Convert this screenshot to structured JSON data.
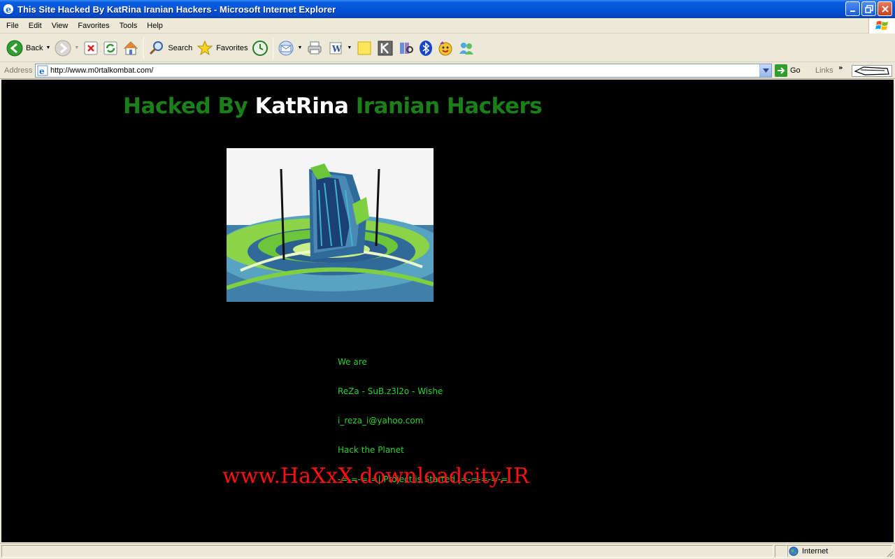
{
  "window": {
    "title": "This Site Hacked By KatRina Iranian Hackers - Microsoft Internet Explorer"
  },
  "menu": [
    "File",
    "Edit",
    "View",
    "Favorites",
    "Tools",
    "Help"
  ],
  "toolbar": {
    "back_label": "Back",
    "search_label": "Search",
    "favorites_label": "Favorites"
  },
  "address": {
    "label": "Address",
    "url": "http://www.m0rtalkombat.com/",
    "go_label": "Go",
    "links_label": "Links"
  },
  "page": {
    "headline_part1": "Hacked By ",
    "headline_part2": "KatRina",
    "headline_part3": " Iranian Hackers",
    "info_lines": [
      "We are",
      "ReZa - SuB.z3l2o - Wishe",
      "i_reza_i@yahoo.com",
      "Hack the Planet",
      "-=-=-=-=| Project is Started |=-=-=-=-=-"
    ],
    "site_link": "www.HaXxX.downloadcity.IR",
    "colors": {
      "background": "#000000",
      "headline_green": "#1a7f18",
      "headline_white": "#ffffff",
      "info_green": "#2ad12a",
      "link_red": "#ff1010"
    }
  },
  "status": {
    "zone_label": "Internet"
  },
  "icons": [
    "ie-icon",
    "back-icon",
    "forward-icon",
    "stop-icon",
    "refresh-icon",
    "home-icon",
    "search-icon",
    "favorites-star-icon",
    "history-icon",
    "mail-icon",
    "print-icon",
    "edit-icon",
    "note-icon",
    "k-icon",
    "research-icon",
    "bluetooth-icon",
    "messenger-icon",
    "contacts-icon",
    "go-arrow-icon",
    "globe-icon",
    "windows-logo-icon"
  ]
}
